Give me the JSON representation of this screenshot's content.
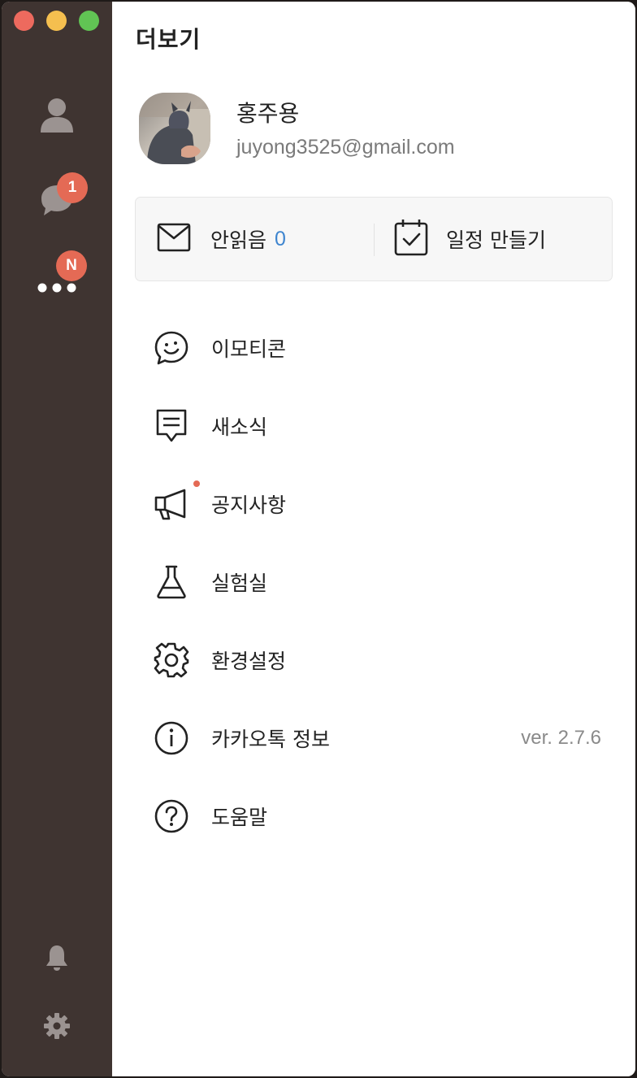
{
  "sidebar": {
    "chats_badge": "1",
    "more_badge": "N"
  },
  "header": {
    "title": "더보기"
  },
  "profile": {
    "name": "홍주용",
    "email": "juyong3525@gmail.com"
  },
  "quick_actions": {
    "unread_label": "안읽음",
    "unread_count": "0",
    "schedule_label": "일정 만들기"
  },
  "menu": {
    "items": [
      {
        "label": "이모티콘",
        "icon": "emoticon-icon"
      },
      {
        "label": "새소식",
        "icon": "news-icon"
      },
      {
        "label": "공지사항",
        "icon": "megaphone-icon"
      },
      {
        "label": "실험실",
        "icon": "flask-icon"
      },
      {
        "label": "환경설정",
        "icon": "gear-icon"
      },
      {
        "label": "카카오톡 정보",
        "icon": "info-icon",
        "value": "ver. 2.7.6"
      },
      {
        "label": "도움말",
        "icon": "help-icon"
      }
    ]
  },
  "colors": {
    "sidebar_bg": "#3f3431",
    "badge": "#e46a55",
    "unread_count": "#3e85cf"
  }
}
